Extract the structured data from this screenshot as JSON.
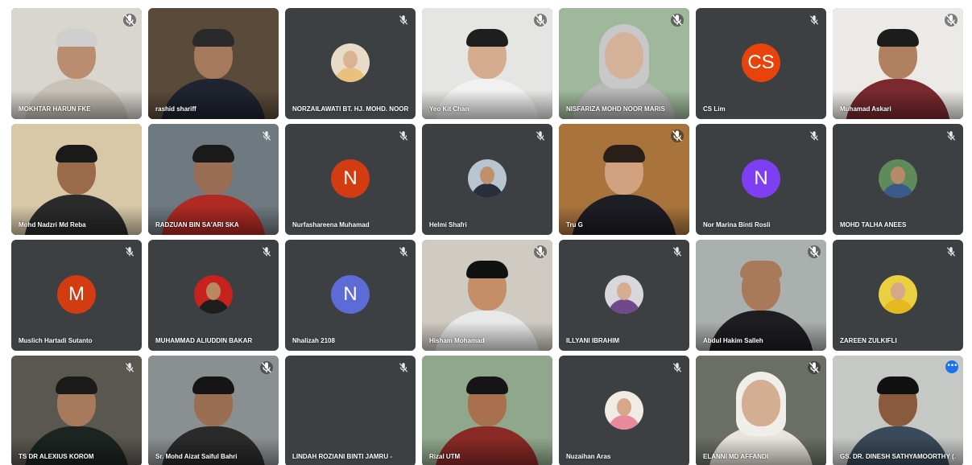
{
  "participants": [
    {
      "name": "MOKHTAR HARUN FKE",
      "type": "video",
      "mic": "muted-faint",
      "avatar": "man-glasses-grey-hair",
      "bg": "#d9d6d0",
      "skin": "#b98d6e",
      "hair": "#cfcfcf",
      "clothes": "#c8c2b8"
    },
    {
      "name": "rashid shariff",
      "type": "video",
      "mic": "none",
      "avatar": "man-headset-beard",
      "bg": "#5a4a3a",
      "skin": "#a57a5c",
      "hair": "#2a2a2a",
      "clothes": "#1f2430"
    },
    {
      "name": "NORZAILAWATI BT. HJ. MOHD. NOOR",
      "type": "photo",
      "mic": "muted",
      "photo_bg": "#e8dcc8",
      "photo_skin": "#d9b393",
      "photo_cloth": "#e8c27a"
    },
    {
      "name": "Yeo Kit Chan",
      "type": "video",
      "mic": "muted-faint",
      "avatar": "man-glasses",
      "bg": "#e5e5e3",
      "skin": "#d4ad8e",
      "hair": "#1e1e1e",
      "clothes": "#f1f1f1"
    },
    {
      "name": "NISFARIZA MOHD NOOR MARIS",
      "type": "video",
      "mic": "muted-faint",
      "avatar": "woman-hijab-greenhouse",
      "bg": "#9fb79a",
      "skin": "#d4b29a",
      "hair": "#c8c8c8",
      "clothes": "#b8b8b8"
    },
    {
      "name": "CS Lim",
      "type": "letter",
      "mic": "muted",
      "letter": "CS",
      "color": "#e8430b"
    },
    {
      "name": "Muhamad Askari",
      "type": "video",
      "mic": "muted-faint",
      "avatar": "man-glasses",
      "bg": "#eceae6",
      "skin": "#b08060",
      "hair": "#1c1c1c",
      "clothes": "#7a2a2e"
    },
    {
      "name": "Mohd Nadzri Md Reba",
      "type": "video",
      "mic": "none",
      "avatar": "man-glasses-plant",
      "bg": "#d8c8a8",
      "skin": "#9a6b4a",
      "hair": "#1a1a1a",
      "clothes": "#2b2b2b"
    },
    {
      "name": "RADZUAN BIN SA'ARI SKA",
      "type": "video",
      "mic": "muted",
      "avatar": "man-red-shirt",
      "bg": "#6e7a80",
      "skin": "#9a6e55",
      "hair": "#1a1a1a",
      "clothes": "#b02a24"
    },
    {
      "name": "Nurfashareena Muhamad",
      "type": "letter",
      "mic": "muted",
      "letter": "N",
      "color": "#d33b10"
    },
    {
      "name": "Helmi Shafri",
      "type": "photo",
      "mic": "muted",
      "photo_bg": "#b8c4cf",
      "photo_skin": "#c08f6c",
      "photo_cloth": "#2a2e3a"
    },
    {
      "name": "Tru G",
      "type": "video",
      "mic": "muted-faint",
      "avatar": "woman-curly",
      "bg": "#a8743c",
      "skin": "#d2a280",
      "hair": "#2a1e18",
      "clothes": "#1d1d24"
    },
    {
      "name": "Nor Marina Binti Rosli",
      "type": "letter",
      "mic": "muted",
      "letter": "N",
      "color": "#7e3ff2"
    },
    {
      "name": "MOHD TALHA ANEES",
      "type": "photo",
      "mic": "muted",
      "photo_bg": "#5f8a5a",
      "photo_skin": "#b98a68",
      "photo_cloth": "#3a5a8a"
    },
    {
      "name": "Muslich Hartadi Sutanto",
      "type": "letter",
      "mic": "muted",
      "letter": "M",
      "color": "#d33b10"
    },
    {
      "name": "MUHAMMAD ALIUDDIN BAKAR",
      "type": "photo",
      "mic": "muted",
      "photo_bg": "#c8221e",
      "photo_skin": "#b88862",
      "photo_cloth": "#1e1e1e"
    },
    {
      "name": "Nhalizah 2108",
      "type": "letter",
      "mic": "muted",
      "letter": "N",
      "color": "#5c6bd6"
    },
    {
      "name": "Hisham Mohamad",
      "type": "video",
      "mic": "muted-faint",
      "avatar": "man-glasses-office",
      "bg": "#cfcac2",
      "skin": "#c48f68",
      "hair": "#111111",
      "clothes": "#e8e8e8"
    },
    {
      "name": "ILLYANI IBRAHIM",
      "type": "photo",
      "mic": "muted",
      "photo_bg": "#d8d8dc",
      "photo_skin": "#d6ad90",
      "photo_cloth": "#6e4a8a"
    },
    {
      "name": "Abdul Hakim Salleh",
      "type": "video",
      "mic": "muted-faint",
      "avatar": "man-bald",
      "bg": "#aab0ae",
      "skin": "#a87a5a",
      "hair": "#a87a5a",
      "clothes": "#1e1e22"
    },
    {
      "name": "ZAREEN ZULKIFLI",
      "type": "photo",
      "mic": "muted",
      "photo_bg": "#e8d040",
      "photo_skin": "#d6a888",
      "photo_cloth": "#e6b820"
    },
    {
      "name": "TS DR ALEXIUS KOROM",
      "type": "video",
      "mic": "muted",
      "avatar": "man-glasses-dark",
      "bg": "#5a5650",
      "skin": "#a87a5c",
      "hair": "#1a1a1a",
      "clothes": "#1c2420"
    },
    {
      "name": "Sr. Mohd Aizat Saiful Bahri",
      "type": "video",
      "mic": "muted-faint",
      "avatar": "man-office",
      "bg": "#8a8f92",
      "skin": "#9a6e52",
      "hair": "#151515",
      "clothes": "#2a2a2a"
    },
    {
      "name": "LINDAH ROZIANI BINTI JAMRU -",
      "type": "blank",
      "mic": "muted"
    },
    {
      "name": "Rizal UTM",
      "type": "video",
      "mic": "none",
      "avatar": "man-greenhouse",
      "bg": "#8fa88c",
      "skin": "#a8704e",
      "hair": "#151515",
      "clothes": "#8a2a26"
    },
    {
      "name": "Nuzaihan Aras",
      "type": "photo",
      "mic": "muted",
      "photo_bg": "#f0ece4",
      "photo_skin": "#d6a888",
      "photo_cloth": "#e88a9a"
    },
    {
      "name": "ELANNI MD AFFANDI",
      "type": "video",
      "mic": "muted-faint",
      "avatar": "woman-hijab",
      "bg": "#6a6e64",
      "skin": "#d4ae92",
      "hair": "#f0eee8",
      "clothes": "#e8e4dc"
    },
    {
      "name": "GS. DR. DINESH SATHYAMOORTHY (...",
      "type": "video",
      "mic": "more",
      "active": true,
      "avatar": "man-headset",
      "bg": "#c6c8c6",
      "skin": "#8a5a3c",
      "hair": "#111111",
      "clothes": "#3a4a5a"
    }
  ]
}
